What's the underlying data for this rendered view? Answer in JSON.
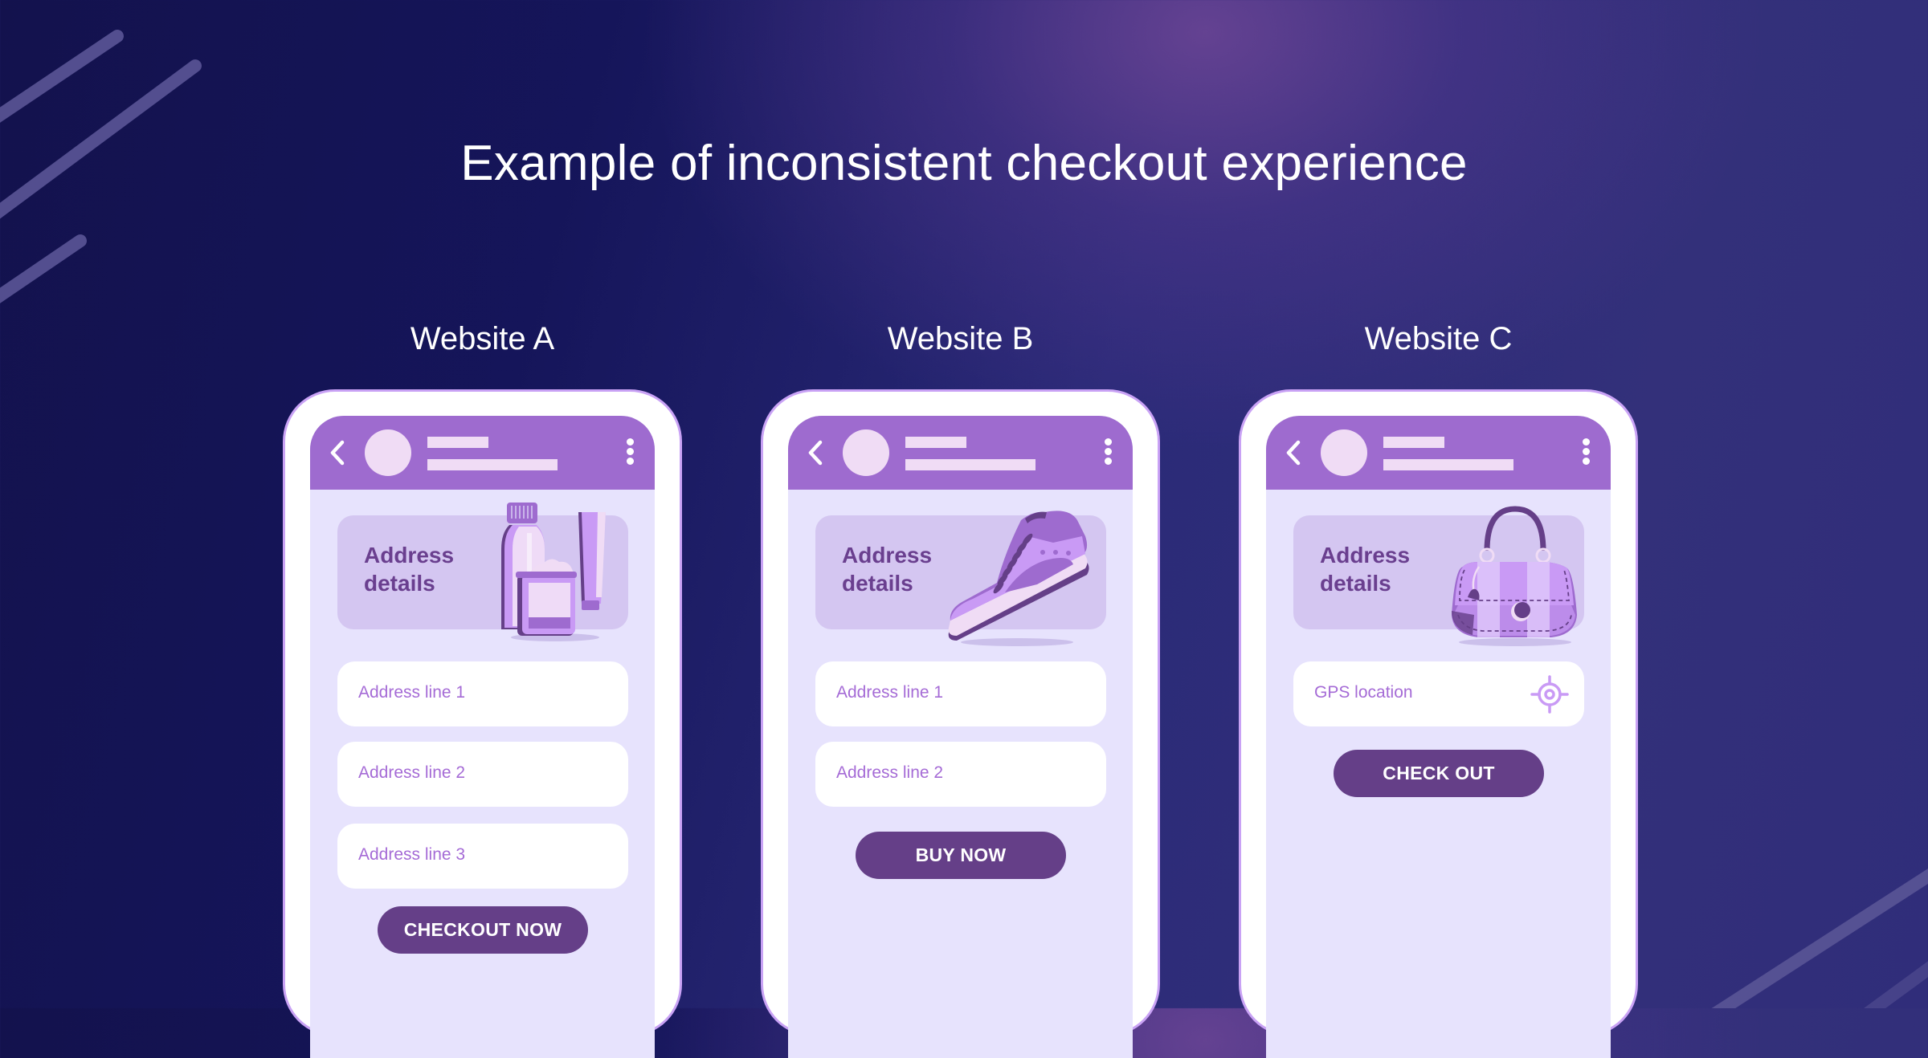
{
  "page": {
    "title": "Example of inconsistent checkout experience"
  },
  "colors": {
    "background_dark": "#13124d",
    "background_glow": "#5a3f85",
    "phone_frame": "#ffffff",
    "phone_outline": "#c9a2f5",
    "header": "#9e6bcf",
    "screen": "#e7e3fd",
    "card": "#d4c6f1",
    "card_text": "#6a3f8f",
    "placeholder_text": "#a56bd6",
    "button": "#653f88",
    "button_text": "#ffffff"
  },
  "websites": [
    {
      "label": "Website A",
      "header": {
        "back_icon": "chevron-left-icon",
        "menu_icon": "kebab-menu-icon"
      },
      "card": {
        "title_line1": "Address",
        "title_line2": "details",
        "illustration": "cosmetics-bottles-illustration"
      },
      "fields": [
        {
          "placeholder": "Address line 1"
        },
        {
          "placeholder": "Address line 2"
        },
        {
          "placeholder": "Address line 3"
        }
      ],
      "button_label": "CHECKOUT NOW"
    },
    {
      "label": "Website B",
      "header": {
        "back_icon": "chevron-left-icon",
        "menu_icon": "kebab-menu-icon"
      },
      "card": {
        "title_line1": "Address",
        "title_line2": "details",
        "illustration": "sneaker-illustration"
      },
      "fields": [
        {
          "placeholder": "Address line 1"
        },
        {
          "placeholder": "Address line 2"
        }
      ],
      "button_label": "BUY NOW"
    },
    {
      "label": "Website C",
      "header": {
        "back_icon": "chevron-left-icon",
        "menu_icon": "kebab-menu-icon"
      },
      "card": {
        "title_line1": "Address",
        "title_line2": "details",
        "illustration": "handbag-illustration"
      },
      "fields": [
        {
          "placeholder": "GPS location",
          "icon": "gps-target-icon"
        }
      ],
      "button_label": "CHECK OUT"
    }
  ]
}
